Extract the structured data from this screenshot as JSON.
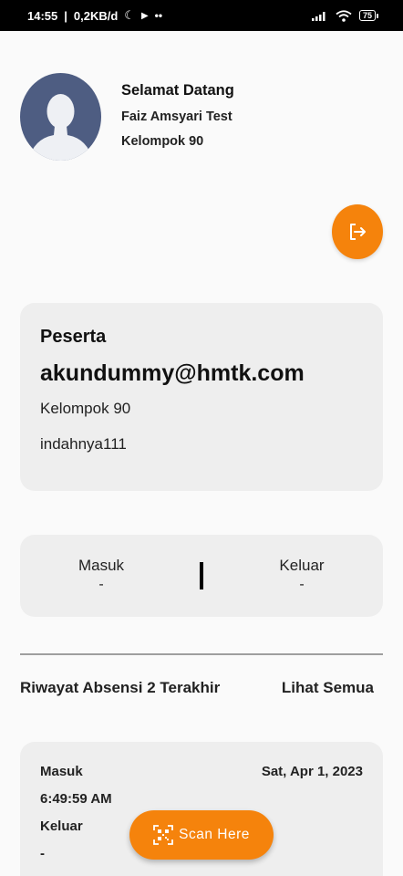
{
  "status_bar": {
    "time": "14:55",
    "network_speed": "0,2KB/d",
    "battery": "75"
  },
  "header": {
    "greeting": "Selamat Datang",
    "user_name": "Faiz Amsyari Test",
    "group": "Kelompok 90"
  },
  "participant_card": {
    "role": "Peserta",
    "email": "akundummy@hmtk.com",
    "group": "Kelompok 90",
    "username": "indahnya111"
  },
  "attendance": {
    "in_label": "Masuk",
    "in_value": "-",
    "out_label": "Keluar",
    "out_value": "-"
  },
  "history": {
    "title": "Riwayat Absensi 2 Terakhir",
    "see_all": "Lihat Semua",
    "items": [
      {
        "in_label": "Masuk",
        "date": "Sat, Apr 1, 2023",
        "in_time": "6:49:59 AM",
        "out_label": "Keluar",
        "out_time": "-"
      }
    ]
  },
  "scan_button": {
    "label": "Scan Here"
  },
  "colors": {
    "accent": "#f5830c",
    "card": "#eeeeee",
    "avatar": "#4e5d82"
  }
}
